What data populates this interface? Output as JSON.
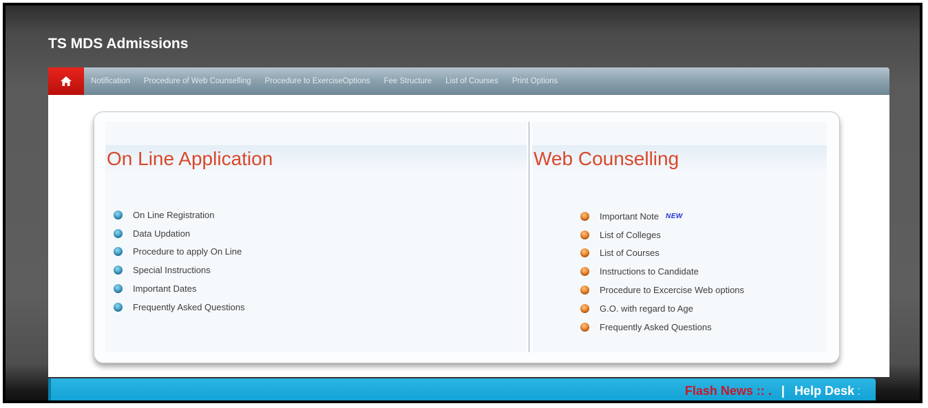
{
  "site": {
    "title": "TS MDS Admissions"
  },
  "nav": {
    "home_icon": "home-icon",
    "items": [
      "Notification",
      "Procedure of Web Counselling",
      "Procedure to ExerciseOptions",
      "Fee Structure",
      "List of Courses",
      "Print Options"
    ]
  },
  "online_application": {
    "title": "On Line Application",
    "links": [
      "On Line Registration",
      "Data Updation",
      "Procedure to apply On Line",
      "Special Instructions",
      "Important Dates",
      "Frequently Asked Questions"
    ]
  },
  "web_counselling": {
    "title": "Web Counselling",
    "new_badge": "NEW",
    "links": [
      "Important Note",
      "List of Colleges",
      "List of Courses",
      "Instructions to Candidate",
      "Procedure to Excercise Web options",
      "G.O. with regard to Age",
      "Frequently Asked Questions"
    ]
  },
  "news_bar": {
    "flash_news": "Flash News :: .",
    "separator": "|",
    "help_desk": "Help Desk",
    "help_colon": ":"
  },
  "colors": {
    "accent_red": "#d9482a",
    "home_red": "#e8231c",
    "news_blue": "#1aa8da",
    "bullet_blue": "#2a91bf",
    "bullet_orange": "#e56f11"
  }
}
